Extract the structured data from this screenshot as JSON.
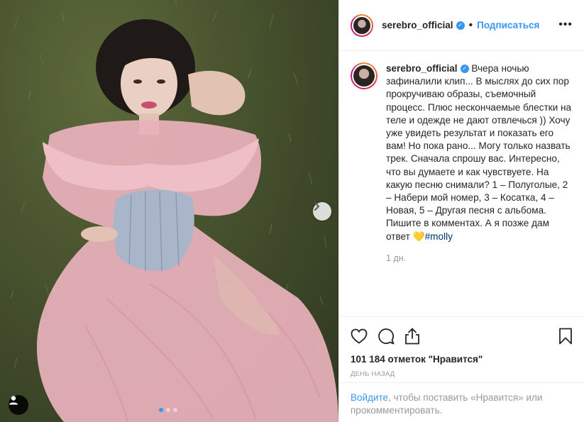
{
  "post": {
    "username": "serebro_official",
    "follow_label": "Подписаться",
    "separator": "•",
    "more_label": "•••",
    "caption": "Вчера ночью зафиналили клип... В мыслях до сих пор прокручиваю образы, съемочный процесс. Плюс нескончаемые блестки на теле и одежде не дают отвлечься )) Хочу уже увидеть результат и показать его вам! Но пока рано... Могу только назвать трек. Сначала спрошу вас. Интересно, что вы думаете и как чувствуете. На какую песню снимали? 1 – Полуголые, 2 – Набери мой номер, 3 – Косатка, 4 – Новая, 5 – Другая песня с альбома. Пишите в комментах. А я позже дам ответ",
    "emoji": "💛",
    "hashtag": "#molly",
    "time_ago": "1 дн.",
    "likes": "101 184 отметок \"Нравится\"",
    "date": "день назад",
    "login_link": "Войдите",
    "login_text": ", чтобы поставить «Нравится» или прокомментировать.",
    "carousel": {
      "total": 3,
      "active": 1
    }
  },
  "icons": {
    "like": "heart-icon",
    "comment": "comment-icon",
    "share": "share-icon",
    "save": "bookmark-icon",
    "next": "chevron-right-icon",
    "tag": "user-tag-icon",
    "verified": "verified-badge-icon"
  },
  "colors": {
    "accent": "#3897f0",
    "text": "#262626",
    "muted": "#999999",
    "hashtag": "#003569"
  }
}
